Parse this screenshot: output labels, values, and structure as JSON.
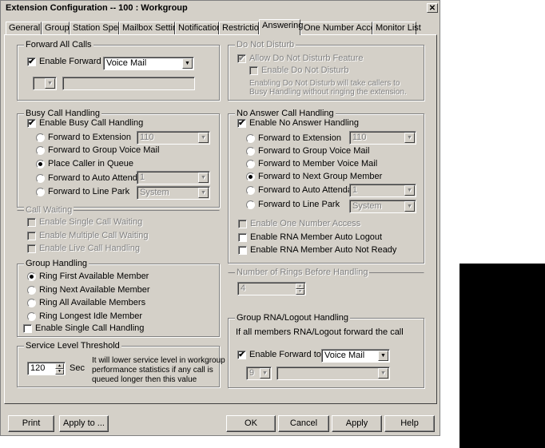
{
  "window": {
    "title": "Extension Configuration -- 100 : Workgroup",
    "close_label": "✕"
  },
  "tabs": [
    "General",
    "Group",
    "Station Speed",
    "Mailbox Setting",
    "Notification",
    "Restriction",
    "Answering",
    "One Number Access",
    "Monitor List"
  ],
  "active_tab": "Answering",
  "forward_all_calls": {
    "legend": "Forward All Calls",
    "enable_label": "Enable Forward to",
    "enable_checked": true,
    "target_value": "Voice Mail",
    "sub_select_value": "",
    "sub_field_value": ""
  },
  "do_not_disturb": {
    "legend": "Do Not Disturb",
    "allow_label": "Allow Do Not Disturb Feature",
    "allow_checked": true,
    "enable_label": "Enable Do Not Disturb",
    "enable_checked": false,
    "note_line1": "Enabling Do Not Disturb will take callers to",
    "note_line2": "Busy Handling without ringing the extension."
  },
  "busy_call_handling": {
    "legend": "Busy Call Handling",
    "enable_label": "Enable Busy Call Handling",
    "enable_checked": true,
    "options": [
      {
        "label": "Forward to Extension",
        "checked": false,
        "value": "110"
      },
      {
        "label": "Forward to Group Voice Mail",
        "checked": false,
        "value": ""
      },
      {
        "label": "Place Caller in Queue",
        "checked": true,
        "value": ""
      },
      {
        "label": "Forward to Auto Attendant",
        "checked": false,
        "value": "1"
      },
      {
        "label": "Forward to Line Park",
        "checked": false,
        "value": "System"
      }
    ]
  },
  "no_answer_handling": {
    "legend": "No Answer Call Handling",
    "enable_label": "Enable No Answer Handling",
    "enable_checked": true,
    "options": [
      {
        "label": "Forward to Extension",
        "checked": false,
        "value": "110"
      },
      {
        "label": "Forward to Group Voice Mail",
        "checked": false,
        "value": ""
      },
      {
        "label": "Forward to Member Voice Mail",
        "checked": false,
        "value": ""
      },
      {
        "label": "Forward to Next Group Member",
        "checked": true,
        "value": ""
      },
      {
        "label": "Forward to Auto Attendant",
        "checked": false,
        "value": "1"
      },
      {
        "label": "Forward to Line Park",
        "checked": false,
        "value": "System"
      }
    ],
    "one_number_access_label": "Enable One Number Access",
    "one_number_access_checked": false,
    "rna_logout_label": "Enable RNA Member Auto Logout",
    "rna_logout_checked": false,
    "rna_not_ready_label": "Enable RNA Member Auto Not Ready",
    "rna_not_ready_checked": false
  },
  "call_waiting": {
    "legend": "Call Waiting",
    "single_label": "Enable Single Call Waiting",
    "multiple_label": "Enable Multiple Call Waiting",
    "live_label": "Enable Live Call Handling"
  },
  "rings_before_handling": {
    "legend": "Number of Rings Before Handling",
    "value": "4"
  },
  "group_handling": {
    "legend": "Group Handling",
    "options": [
      {
        "label": "Ring First Available Member",
        "checked": true
      },
      {
        "label": "Ring Next Available Member",
        "checked": false
      },
      {
        "label": "Ring All Available Members",
        "checked": false
      },
      {
        "label": "Ring Longest Idle Member",
        "checked": false
      }
    ],
    "single_call_label": "Enable Single Call Handling",
    "single_call_checked": false
  },
  "group_rna": {
    "legend": "Group RNA/Logout Handling",
    "description": "If all members RNA/Logout forward the call",
    "enable_label": "Enable Forward to",
    "enable_checked": true,
    "target_value": "Voice Mail",
    "sub_select_value": "9",
    "sub_field_value": ""
  },
  "service_level": {
    "legend": "Service Level Threshold",
    "value": "120",
    "unit": "Sec",
    "note_line1": "It will lower service level in workgroup",
    "note_line2": "performance statistics if any call is",
    "note_line3": "queued longer then this value"
  },
  "buttons": {
    "print": "Print",
    "apply_to": "Apply to ...",
    "ok": "OK",
    "cancel": "Cancel",
    "apply": "Apply",
    "help": "Help"
  }
}
